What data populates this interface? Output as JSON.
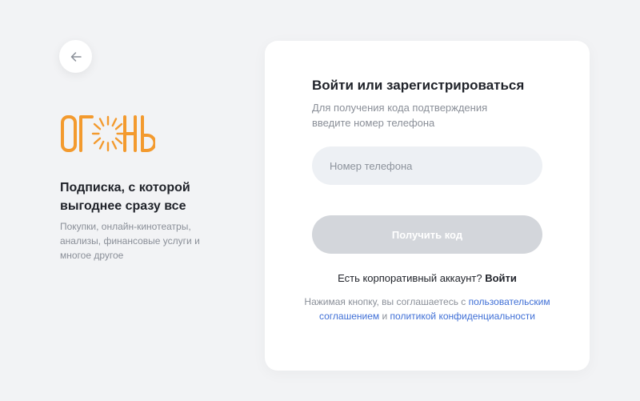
{
  "colors": {
    "background": "#f2f3f5",
    "card": "#ffffff",
    "brand_orange": "#f39a2e",
    "link_blue": "#3f6fd6",
    "button_disabled": "#d3d6db",
    "input_background": "#edf0f4"
  },
  "header": {
    "back_icon": "arrow-left-icon"
  },
  "brand": {
    "logo_text": "ОГОНЬ"
  },
  "promo": {
    "title": "Подписка, с которой выгоднее сразу все",
    "description": "Покупки, онлайн-кинотеатры, анализы, финансовые услуги и многое другое"
  },
  "login": {
    "title": "Войти или зарегистрироваться",
    "subtitle": "Для получения кода подтверждения введите номер телефона",
    "phone_placeholder": "Номер телефона",
    "phone_value": "",
    "submit_label": "Получить код",
    "submit_enabled": false,
    "corporate_question": "Есть корпоративный аккаунт?",
    "corporate_link": "Войти",
    "agreement_prefix": "Нажимая кнопку, вы соглашаетесь с",
    "agreement_terms_link": "пользовательским соглашением",
    "agreement_and": "и",
    "agreement_privacy_link": "политикой конфиденциальности"
  }
}
